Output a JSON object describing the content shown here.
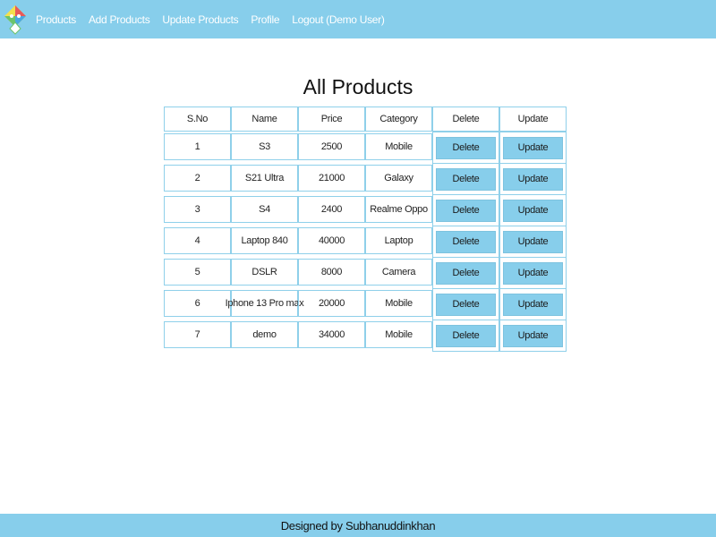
{
  "nav": {
    "logo_icon": "diamond-logo-icon",
    "links": [
      "Products",
      "Add Products",
      "Update Products",
      "Profile",
      "Logout (Demo User)"
    ]
  },
  "main": {
    "title": "All Products",
    "table": {
      "headers": [
        "S.No",
        "Name",
        "Price",
        "Category",
        "Delete",
        "Update"
      ],
      "rows": [
        {
          "sno": "1",
          "name": "S3",
          "price": "2500",
          "category": "Mobile",
          "delete_label": "Delete",
          "update_label": "Update"
        },
        {
          "sno": "2",
          "name": "S21 Ultra",
          "price": "21000",
          "category": "Galaxy",
          "delete_label": "Delete",
          "update_label": "Update"
        },
        {
          "sno": "3",
          "name": "S4",
          "price": "2400",
          "category": "Realme Oppo",
          "delete_label": "Delete",
          "update_label": "Update"
        },
        {
          "sno": "4",
          "name": "Laptop 840",
          "price": "40000",
          "category": "Laptop",
          "delete_label": "Delete",
          "update_label": "Update"
        },
        {
          "sno": "5",
          "name": "DSLR",
          "price": "8000",
          "category": "Camera",
          "delete_label": "Delete",
          "update_label": "Update"
        },
        {
          "sno": "6",
          "name": "Iphone 13 Pro max",
          "price": "20000",
          "category": "Mobile",
          "delete_label": "Delete",
          "update_label": "Update"
        },
        {
          "sno": "7",
          "name": "demo",
          "price": "34000",
          "category": "Mobile",
          "delete_label": "Delete",
          "update_label": "Update"
        }
      ]
    }
  },
  "footer": {
    "text": "Designed by Subhanuddinkhan"
  },
  "colors": {
    "accent": "#87ceeb",
    "border": "#8fd0ea",
    "background": "#ffffff"
  }
}
